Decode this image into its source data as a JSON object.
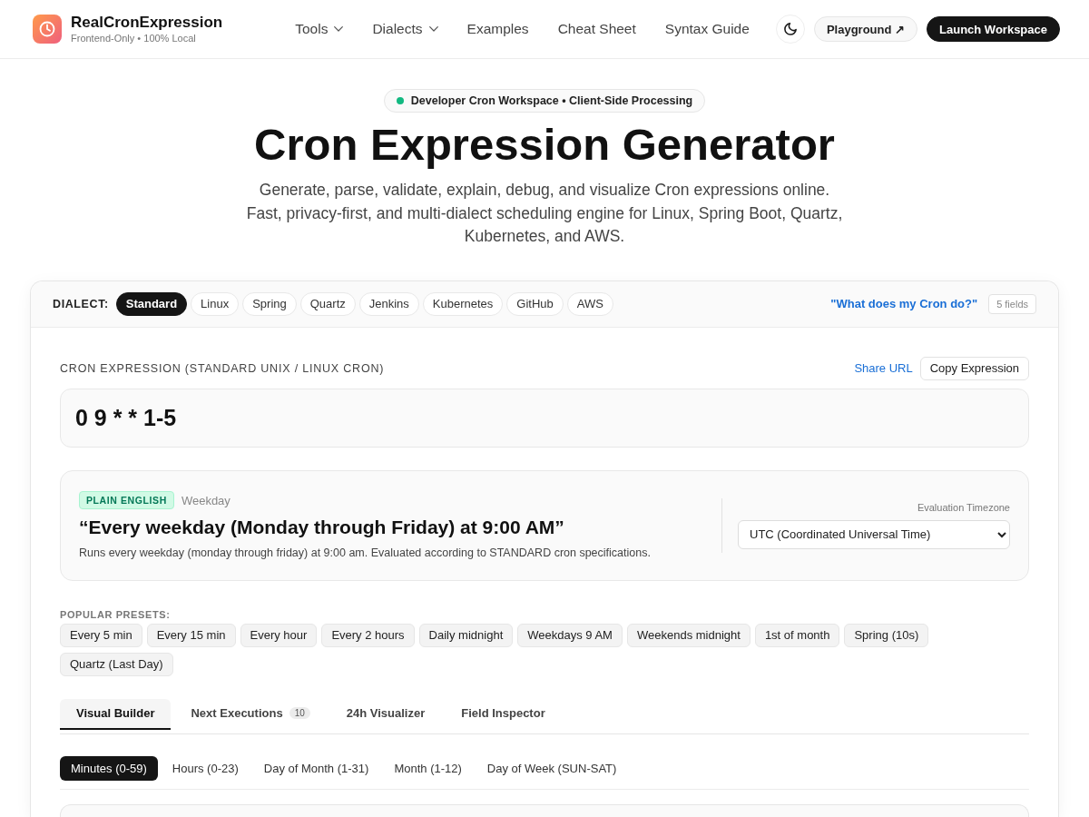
{
  "header": {
    "brand": {
      "name": "RealCronExpression",
      "tagline": "Frontend-Only • 100% Local"
    },
    "nav": [
      {
        "label": "Tools",
        "kind": "dropdown"
      },
      {
        "label": "Dialects",
        "kind": "dropdown"
      },
      {
        "label": "Examples",
        "kind": "link"
      },
      {
        "label": "Cheat Sheet",
        "kind": "link"
      },
      {
        "label": "Syntax Guide",
        "kind": "link"
      }
    ],
    "buttons": [
      {
        "label": "Playground ↗",
        "kind": "secondary"
      },
      {
        "label": "Launch Workspace",
        "kind": "primary"
      }
    ]
  },
  "hero": {
    "badge": "Developer Cron Workspace • Client-Side Processing",
    "title": "Cron Expression Generator",
    "description": "Generate, parse, validate, explain, debug, and visualize Cron expressions online. Fast, privacy-first, and multi-dialect scheduling engine for Linux, Spring Boot, Quartz, Kubernetes, and AWS."
  },
  "generator": {
    "dialect_label": "DIALECT:",
    "dialects": [
      {
        "label": "Standard",
        "selected": true
      },
      {
        "label": "Linux",
        "selected": false
      },
      {
        "label": "Spring",
        "selected": false
      },
      {
        "label": "Quartz",
        "selected": false
      },
      {
        "label": "Jenkins",
        "selected": false
      },
      {
        "label": "Kubernetes",
        "selected": false
      },
      {
        "label": "GitHub",
        "selected": false
      },
      {
        "label": "AWS",
        "selected": false
      }
    ],
    "explain_link": "\"What does my Cron do?\"",
    "field_count": "5 fields",
    "expression": {
      "label": "CRON EXPRESSION (STANDARD UNIX / LINUX CRON)",
      "actions": [
        {
          "label": "Share URL",
          "kind": "link"
        },
        {
          "label": "Copy Expression",
          "kind": "button"
        }
      ],
      "value": "0 9 * * 1-5"
    },
    "explanation": {
      "badge": "PLAIN ENGLISH",
      "category": "Weekday",
      "summary": "“Every weekday (Monday through Friday) at 9:00 AM”",
      "detail": "Runs every weekday (monday through friday) at 9:00 am. Evaluated according to STANDARD cron specifications.",
      "timezone": {
        "label": "Evaluation Timezone",
        "value": "UTC (Coordinated Universal Time)"
      }
    },
    "presets": {
      "label": "POPULAR PRESETS:",
      "items": [
        "Every 5 min",
        "Every 15 min",
        "Every hour",
        "Every 2 hours",
        "Daily midnight",
        "Weekdays 9 AM",
        "Weekends midnight",
        "1st of month",
        "Spring (10s)",
        "Quartz (Last Day)"
      ]
    },
    "tabs": [
      {
        "label": "Visual Builder",
        "selected": true
      },
      {
        "label": "Next Executions",
        "count": "10",
        "selected": false
      },
      {
        "label": "24h Visualizer",
        "selected": false
      },
      {
        "label": "Field Inspector",
        "selected": false
      }
    ],
    "field_tabs": [
      {
        "label": "Minutes (0-59)",
        "selected": true
      },
      {
        "label": "Hours (0-23)",
        "selected": false
      },
      {
        "label": "Day of Month (1-31)",
        "selected": false
      },
      {
        "label": "Month (1-12)",
        "selected": false
      },
      {
        "label": "Day of Week (SUN-SAT)",
        "selected": false
      }
    ]
  }
}
